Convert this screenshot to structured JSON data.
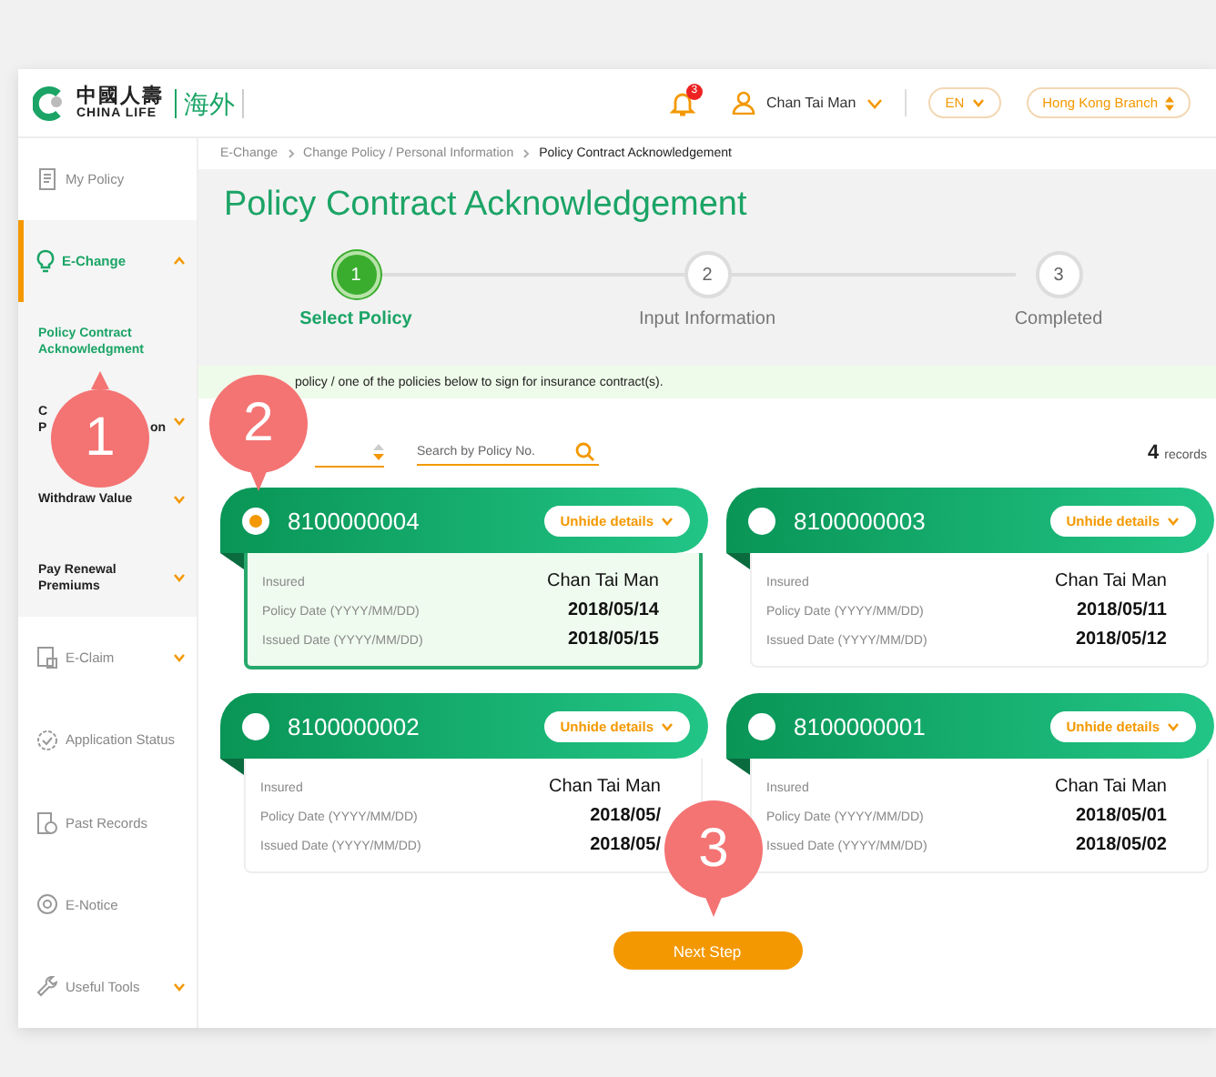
{
  "header": {
    "logo_cn": "中國人壽",
    "logo_en": "CHINA LIFE",
    "logo_tag": "海外",
    "notification_count": "3",
    "user": "Chan Tai Man",
    "language": "EN",
    "branch": "Hong Kong Branch"
  },
  "sidebar": {
    "items": [
      {
        "kind": "item",
        "label": "My Policy",
        "selected": false
      },
      {
        "kind": "group",
        "label": "E-Change",
        "selected": true,
        "expanded": true
      },
      {
        "kind": "sub",
        "lines": [
          [
            "Policy Contract"
          ],
          [
            "Acknowledgment"
          ]
        ],
        "selected": true,
        "expandable": false
      },
      {
        "kind": "sub",
        "lines": [
          [
            "C"
          ],
          [
            "P",
            "on"
          ]
        ],
        "selected": false,
        "expandable": true
      },
      {
        "kind": "sub",
        "lines": [
          [
            "Withdraw Value"
          ]
        ],
        "selected": false,
        "expandable": true
      },
      {
        "kind": "sub",
        "lines": [
          [
            "Pay Renewal"
          ],
          [
            "Premiums"
          ]
        ],
        "selected": false,
        "expandable": true
      },
      {
        "kind": "group",
        "label": "E-Claim",
        "selected": false,
        "expanded": false
      },
      {
        "kind": "item",
        "label": "Application Status",
        "selected": false
      },
      {
        "kind": "item",
        "label": "Past Records",
        "selected": false
      },
      {
        "kind": "item",
        "label": "E-Notice",
        "selected": false
      },
      {
        "kind": "group",
        "label": "Useful Tools",
        "selected": false,
        "expanded": false
      }
    ]
  },
  "breadcrumb": [
    "E-Change",
    "Change Policy / Personal Information",
    "Policy Contract Acknowledgement"
  ],
  "title": "Policy Contract Acknowledgement",
  "steps": [
    {
      "number": "1",
      "label": "Select Policy",
      "selected": true
    },
    {
      "number": "2",
      "label": "Input Information",
      "selected": false
    },
    {
      "number": "3",
      "label": "Completed",
      "selected": false
    }
  ],
  "hint": "policy / one of the policies below to sign for insurance contract(s).",
  "search": {
    "placeholder": "Search by Policy No."
  },
  "records": {
    "count": "4",
    "label": "records"
  },
  "policies": [
    {
      "number": "8100000004",
      "selected": true,
      "toggle": "Unhide details",
      "rows": [
        {
          "label": "Insured",
          "value": "Chan Tai Man"
        },
        {
          "label": "Policy Date (YYYY/MM/DD)",
          "value": "2018/05/14"
        },
        {
          "label": "Issued Date (YYYY/MM/DD)",
          "value": "2018/05/15"
        }
      ]
    },
    {
      "number": "8100000003",
      "selected": false,
      "toggle": "Unhide details",
      "rows": [
        {
          "label": "Insured",
          "value": "Chan Tai Man"
        },
        {
          "label": "Policy Date (YYYY/MM/DD)",
          "value": "2018/05/11"
        },
        {
          "label": "Issued Date (YYYY/MM/DD)",
          "value": "2018/05/12"
        }
      ]
    },
    {
      "number": "8100000002",
      "selected": false,
      "toggle": "Unhide details",
      "rows": [
        {
          "label": "Insured",
          "value": "Chan Tai Man"
        },
        {
          "label": "Policy Date (YYYY/MM/DD)",
          "value": "2018/05/"
        },
        {
          "label": "Issued Date (YYYY/MM/DD)",
          "value": "2018/05/"
        }
      ]
    },
    {
      "number": "8100000001",
      "selected": false,
      "toggle": "Unhide details",
      "rows": [
        {
          "label": "Insured",
          "value": "Chan Tai Man"
        },
        {
          "label": "Policy Date (YYYY/MM/DD)",
          "value": "2018/05/01"
        },
        {
          "label": "Issued Date (YYYY/MM/DD)",
          "value": "2018/05/02"
        }
      ]
    }
  ],
  "next_button": "Next Step",
  "callouts": [
    {
      "label": "1",
      "kind": "up"
    },
    {
      "label": "2",
      "kind": "down"
    },
    {
      "label": "3",
      "kind": "down"
    }
  ]
}
